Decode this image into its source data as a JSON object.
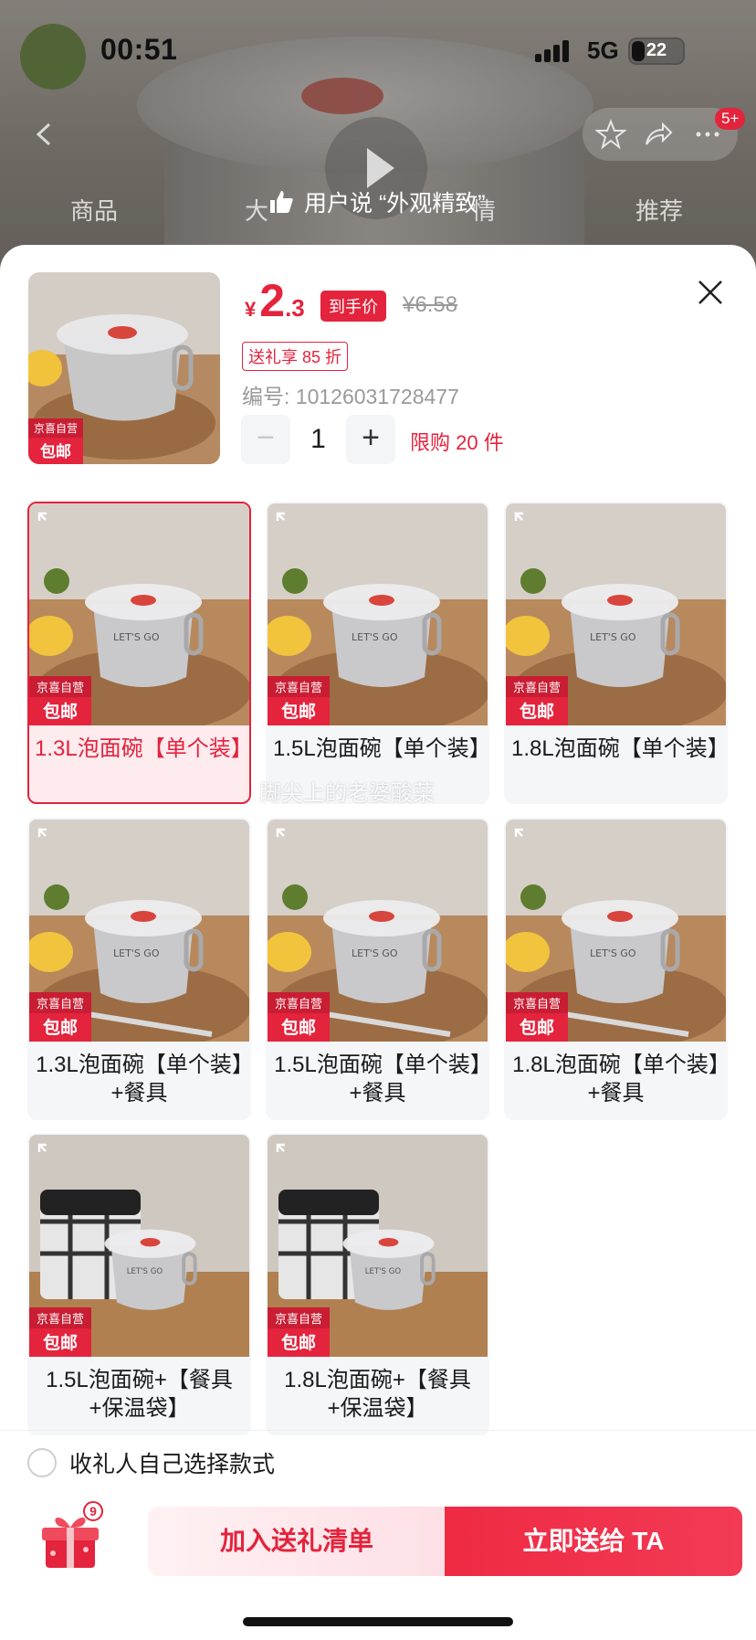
{
  "status_bar": {
    "time": "00:51",
    "network": "5G",
    "battery": "22"
  },
  "nav": {
    "badge": "5+"
  },
  "bg_tabs": [
    "商品",
    "大",
    "情",
    "推荐"
  ],
  "user_says": "用户说 “外观精致”",
  "product": {
    "currency": "¥",
    "price_int": "2",
    "price_dec": ".3",
    "price_tag": "到手价",
    "original_price": "¥6.58",
    "gift_discount": "送礼享 85 折",
    "sku_label": "编号:",
    "sku": "10126031728477",
    "quantity": "1",
    "minus": "−",
    "plus": "+",
    "limit": "限购 20 件",
    "badge_top": "京喜自营",
    "badge_bottom": "包邮"
  },
  "variants": [
    {
      "label": "1.3L泡面碗【单个装】",
      "selected": true,
      "kind": "bowl"
    },
    {
      "label": "1.5L泡面碗【单个装】",
      "selected": false,
      "kind": "bowl"
    },
    {
      "label": "1.8L泡面碗【单个装】",
      "selected": false,
      "kind": "bowl"
    },
    {
      "label": "1.3L泡面碗【单个装】+餐具",
      "selected": false,
      "kind": "bowl-utensils"
    },
    {
      "label": "1.5L泡面碗【单个装】+餐具",
      "selected": false,
      "kind": "bowl-utensils"
    },
    {
      "label": "1.8L泡面碗【单个装】+餐具",
      "selected": false,
      "kind": "bowl-utensils"
    },
    {
      "label": "1.5L泡面碗+【餐具+保温袋】",
      "selected": false,
      "kind": "bowl-bag"
    },
    {
      "label": "1.8L泡面碗+【餐具+保温袋】",
      "selected": false,
      "kind": "bowl-bag"
    }
  ],
  "watermark": "脚尖上的老婆酸菜",
  "option": {
    "label": "收礼人自己选择款式"
  },
  "footer": {
    "gift_count": "9",
    "add_label": "加入送礼清单",
    "send_label": "立即送给 TA"
  },
  "colors": {
    "accent": "#e4233d",
    "selected_bg": "#fdebee",
    "card_bg": "#f5f6f8"
  }
}
